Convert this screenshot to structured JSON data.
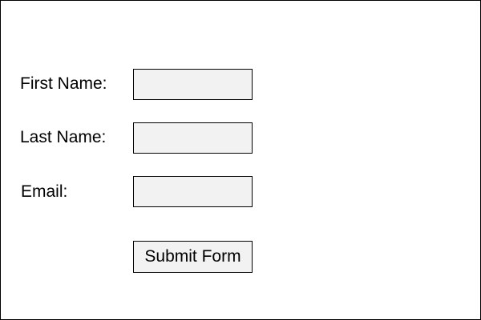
{
  "form": {
    "first_name": {
      "label": "First Name:",
      "value": ""
    },
    "last_name": {
      "label": "Last Name:",
      "value": ""
    },
    "email": {
      "label": "Email:",
      "value": ""
    },
    "submit_label": "Submit Form"
  },
  "colors": {
    "field_background": "#f2f2f2",
    "border": "#000000",
    "page_background": "#ffffff"
  }
}
